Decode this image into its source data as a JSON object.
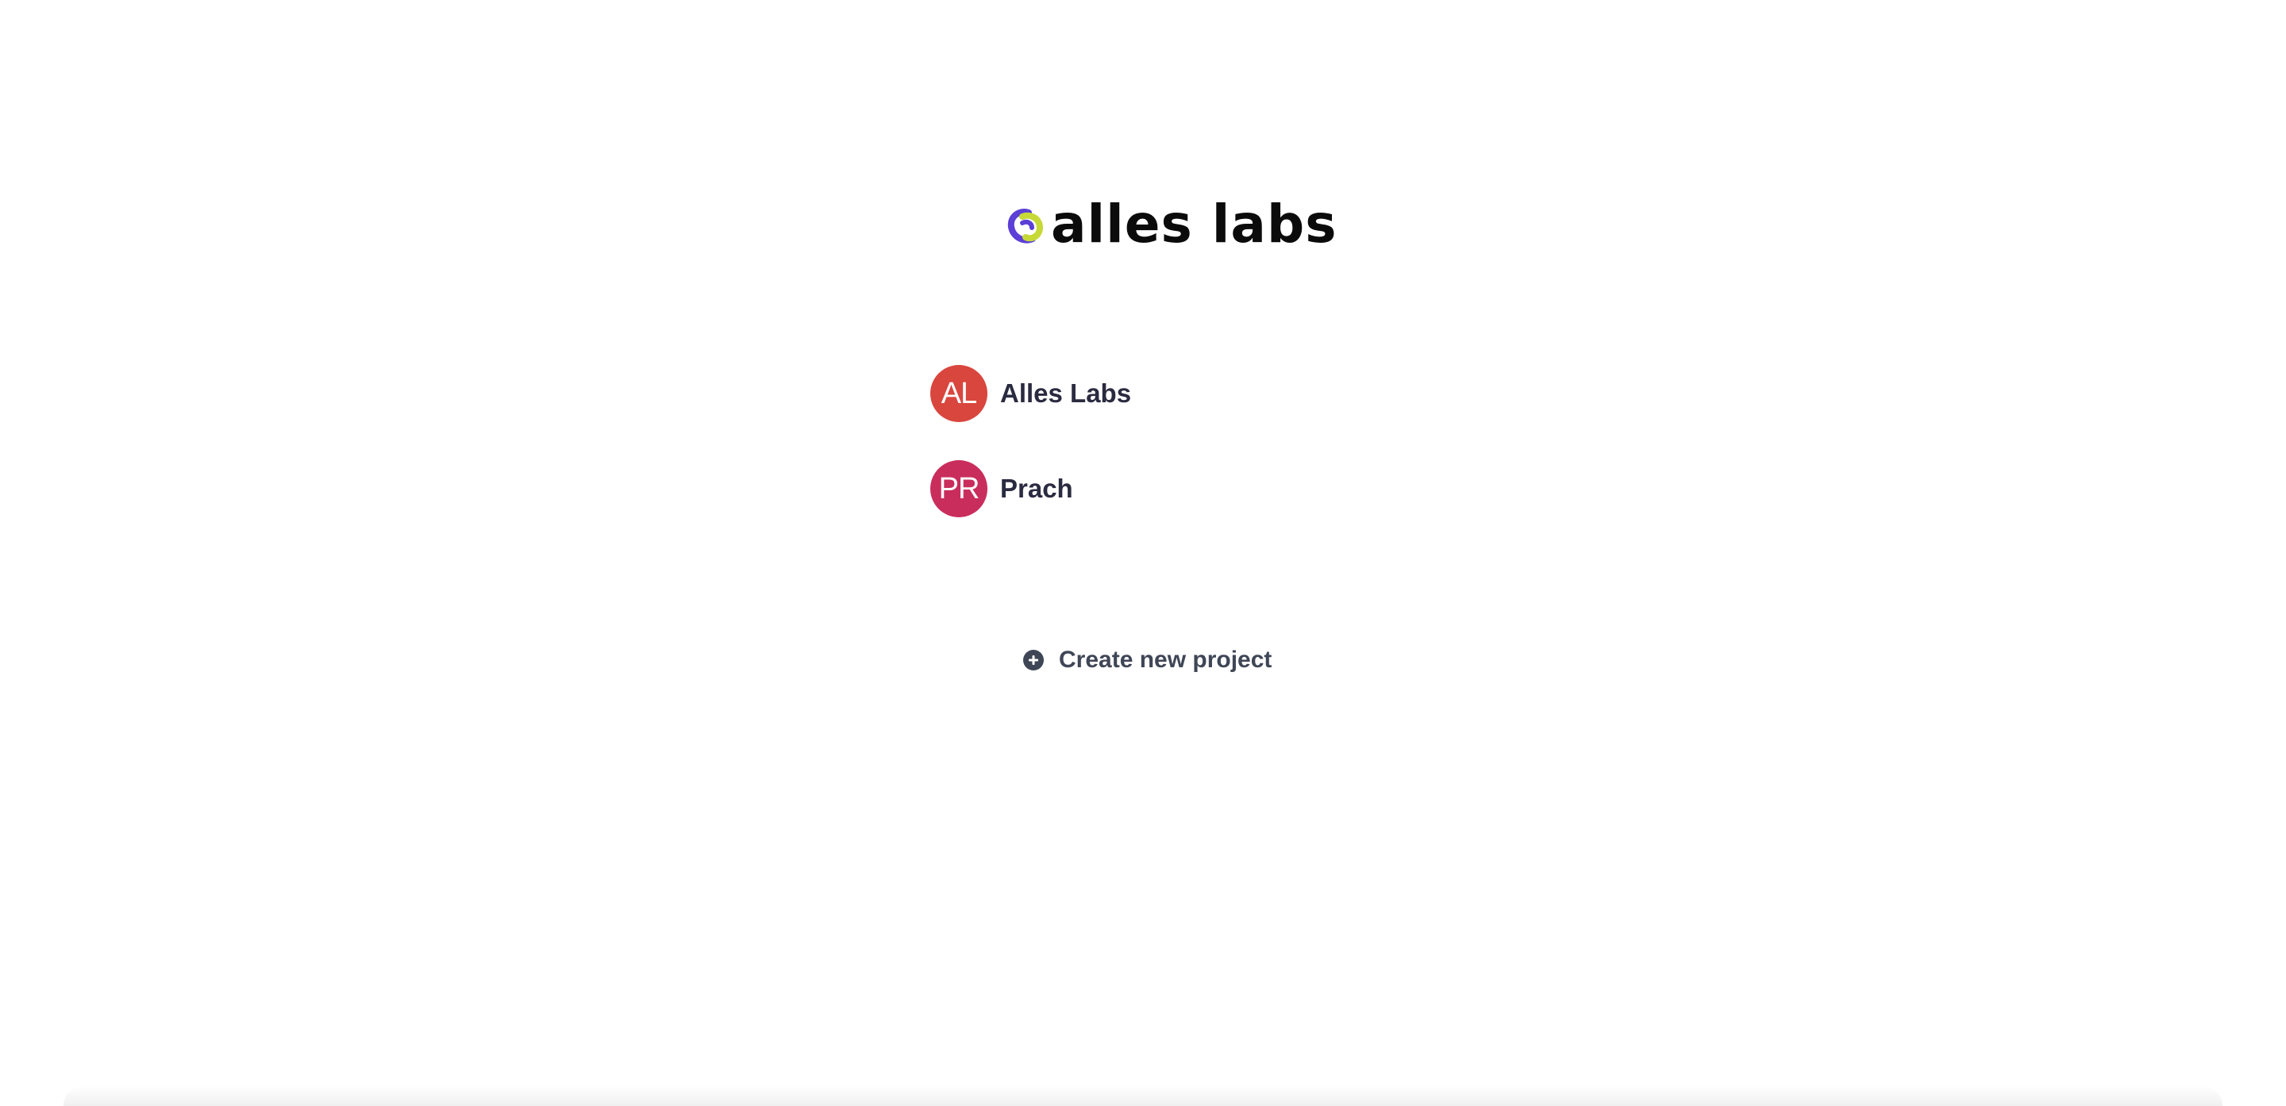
{
  "brand": {
    "name": "alles labs",
    "logo_icon": "alles-labs-logo-icon",
    "colors": {
      "purple": "#5b3fd6",
      "lime": "#c6d936",
      "text": "#0b0b0b"
    }
  },
  "projects": [
    {
      "initials": "AL",
      "name": "Alles Labs",
      "color": "#d9463e"
    },
    {
      "initials": "PR",
      "name": "Prach",
      "color": "#c92d5c"
    }
  ],
  "actions": {
    "create_label": "Create new project",
    "create_icon": "plus-circle-icon"
  }
}
